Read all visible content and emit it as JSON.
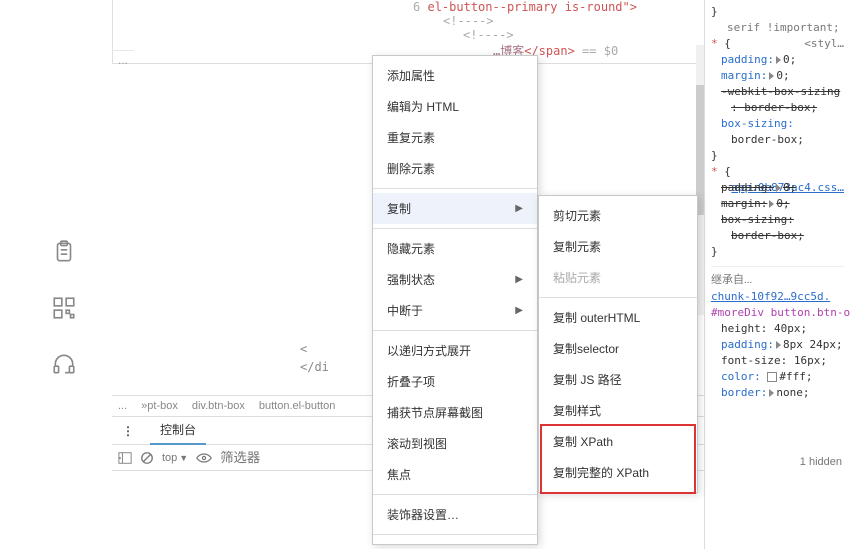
{
  "code": {
    "line1_num": "6",
    "line1": "el-button--primary is-round\">",
    "comment_open": "<!---->",
    "comment_open2": "<!---->",
    "span_close": "</span>",
    "eq0": "== $0",
    "partial_chinese": "…博客",
    "angle_open": "<",
    "close_di": "</di",
    "ellipsis": "..."
  },
  "breadcrumb": {
    "ellipsis": "...",
    "b1": "»pt-box",
    "b2": "div.btn-box",
    "b3": "button.el-button"
  },
  "tabs": {
    "dots": "⋮",
    "active": "控制台"
  },
  "filter": {
    "top": "top",
    "placeholder": "筛选器"
  },
  "hidden": "1 hidden",
  "styles": {
    "brace_close": "}",
    "serif": "serif !important;",
    "style_tag": "<styl…",
    "star": "*",
    "lbrace": "{",
    "padding0": "padding:",
    "zero": "0;",
    "margin0": "margin:",
    "webkit": "-webkit-box-sizing",
    "borderbox_s": ": border-box;",
    "boxsizing": "box-sizing:",
    "borderbox": "border-box;",
    "app_link": "app.0b873ac4.css…",
    "padding_s": "padding:",
    "margin_s": "margin:",
    "boxsizing_s": "box-sizing:",
    "inherit": "继承自...",
    "chunk_link": "chunk-10f92…9cc5d.",
    "selector": "#moreDiv button.btn-outline-danger {",
    "height": "height: 40px;",
    "padding_v": "padding:",
    "padval": "8px 24px;",
    "fontsize": "font-size: 16px;",
    "color": "color:",
    "colorval": "#fff;",
    "border": "border:",
    "borderval": "none;"
  },
  "menu1": [
    "添加属性",
    "编辑为 HTML",
    "重复元素",
    "删除元素",
    "复制",
    "隐藏元素",
    "强制状态",
    "中断于",
    "以递归方式展开",
    "折叠子项",
    "捕获节点屏幕截图",
    "滚动到视图",
    "焦点",
    "装饰器设置…"
  ],
  "menu2": {
    "cut": "剪切元素",
    "copy_el": "复制元素",
    "paste": "粘贴元素",
    "outer": "复制 outerHTML",
    "selector": "复制selector",
    "jspath": "复制 JS 路径",
    "styles": "复制样式",
    "xpath": "复制 XPath",
    "fullxpath": "复制完整的 XPath"
  }
}
